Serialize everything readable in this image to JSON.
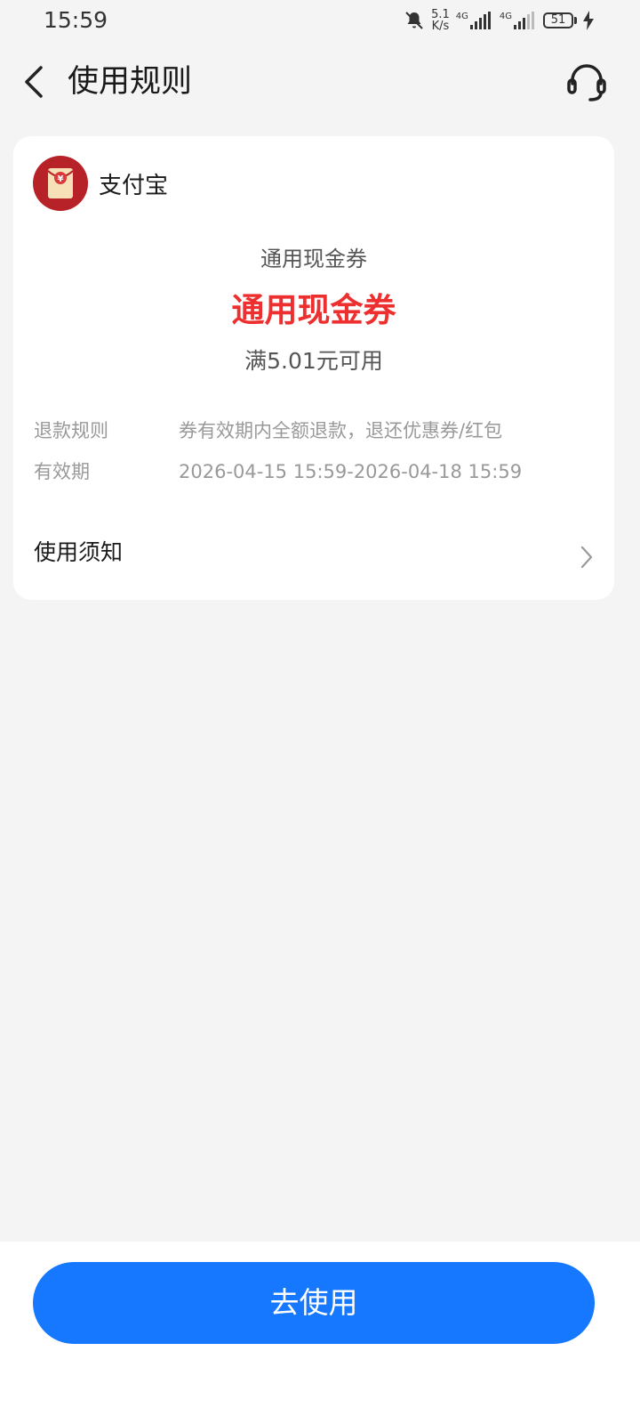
{
  "status_bar": {
    "time": "15:59",
    "net_speed_value": "5.1",
    "net_speed_unit": "K/s",
    "signal_1_label": "4G",
    "signal_2_label": "4G",
    "battery_level": "51",
    "icons": [
      "mute-bell-icon",
      "signal-icon",
      "battery-icon",
      "charging-icon"
    ]
  },
  "nav": {
    "title": "使用规则",
    "icons": [
      "back-icon",
      "customer-service-icon"
    ]
  },
  "card": {
    "merchant_name": "支付宝",
    "merchant_logo_icon": "red-envelope-icon",
    "coupon_subtitle": "通用现金券",
    "coupon_title": "通用现金券",
    "coupon_condition": "满5.01元可用",
    "rules": [
      {
        "key": "退款规则",
        "value": "券有效期内全额退款，退还优惠券/红包"
      },
      {
        "key": "有效期",
        "value": "2026-04-15 15:59-2026-04-18 15:59"
      }
    ],
    "notice_label": "使用须知"
  },
  "footer": {
    "use_button_label": "去使用"
  },
  "colors": {
    "accent_blue": "#1677ff",
    "coupon_red": "#ee2f2f",
    "logo_red": "#b72228",
    "background": "#f4f4f4"
  }
}
